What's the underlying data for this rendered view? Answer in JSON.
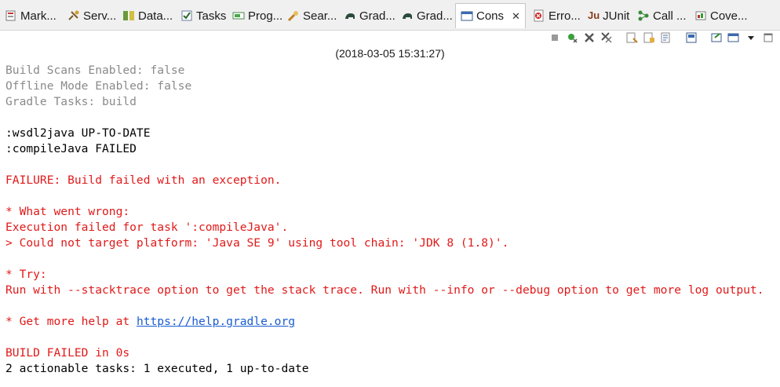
{
  "tabs": [
    {
      "label": "Mark...",
      "icon": "markers-icon"
    },
    {
      "label": "Serv...",
      "icon": "servers-icon"
    },
    {
      "label": "Data...",
      "icon": "data-source-icon"
    },
    {
      "label": "Tasks",
      "icon": "tasks-icon"
    },
    {
      "label": "Prog...",
      "icon": "progress-icon"
    },
    {
      "label": "Sear...",
      "icon": "search-icon"
    },
    {
      "label": "Grad...",
      "icon": "gradle-elephant-icon"
    },
    {
      "label": "Grad...",
      "icon": "gradle-elephant-icon"
    },
    {
      "label": "Cons",
      "icon": "console-icon",
      "close": "✕"
    },
    {
      "label": "Erro...",
      "icon": "error-log-icon"
    },
    {
      "label": "JUnit",
      "icon": "junit-icon",
      "prefix": "Ju"
    },
    {
      "label": "Call ...",
      "icon": "call-hierarchy-icon"
    },
    {
      "label": "Cove...",
      "icon": "coverage-icon"
    }
  ],
  "console": {
    "subtitle": "(2018-03-05 15:31:27)",
    "lines": [
      {
        "text": "Build Scans Enabled: false",
        "color": "gray"
      },
      {
        "text": "Offline Mode Enabled: false",
        "color": "gray"
      },
      {
        "text": "Gradle Tasks: build",
        "color": "gray"
      },
      {
        "text": "",
        "color": "black"
      },
      {
        "text": ":wsdl2java UP-TO-DATE",
        "color": "black"
      },
      {
        "text": ":compileJava FAILED",
        "color": "black"
      },
      {
        "text": "",
        "color": "black"
      },
      {
        "text": "FAILURE: Build failed with an exception.",
        "color": "red"
      },
      {
        "text": "",
        "color": "black"
      },
      {
        "text": "* What went wrong:",
        "color": "red"
      },
      {
        "text": "Execution failed for task ':compileJava'.",
        "color": "red"
      },
      {
        "text": "> Could not target platform: 'Java SE 9' using tool chain: 'JDK 8 (1.8)'.",
        "color": "red"
      },
      {
        "text": "",
        "color": "black"
      },
      {
        "text": "* Try:",
        "color": "red"
      },
      {
        "text": "Run with --stacktrace option to get the stack trace. Run with --info or --debug option to get more log output.",
        "color": "red"
      },
      {
        "text": "",
        "color": "black"
      },
      {
        "text": "* Get more help at ",
        "color": "red",
        "link": "https://help.gradle.org"
      },
      {
        "text": "",
        "color": "black"
      },
      {
        "text": "BUILD FAILED in 0s",
        "color": "red"
      },
      {
        "text": "2 actionable tasks: 1 executed, 1 up-to-date",
        "color": "black"
      }
    ]
  },
  "colors": {
    "error_red": "#e11919",
    "info_gray": "#8a8a8a",
    "link_blue": "#1a5ccf"
  }
}
